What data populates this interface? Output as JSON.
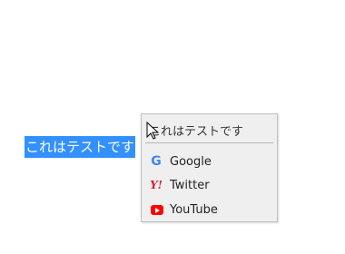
{
  "selection": {
    "text": "これはテストです"
  },
  "context_menu": {
    "header": "これはテストです",
    "items": [
      {
        "label": "Google",
        "icon": "google-icon"
      },
      {
        "label": "Twitter",
        "icon": "yahoo-icon"
      },
      {
        "label": "YouTube",
        "icon": "youtube-icon"
      }
    ]
  },
  "colors": {
    "selection_bg": "#3390ff",
    "menu_bg": "#efefef",
    "google_blue": "#4285f4",
    "yahoo_red": "#d62134",
    "youtube_red": "#ff0000"
  }
}
